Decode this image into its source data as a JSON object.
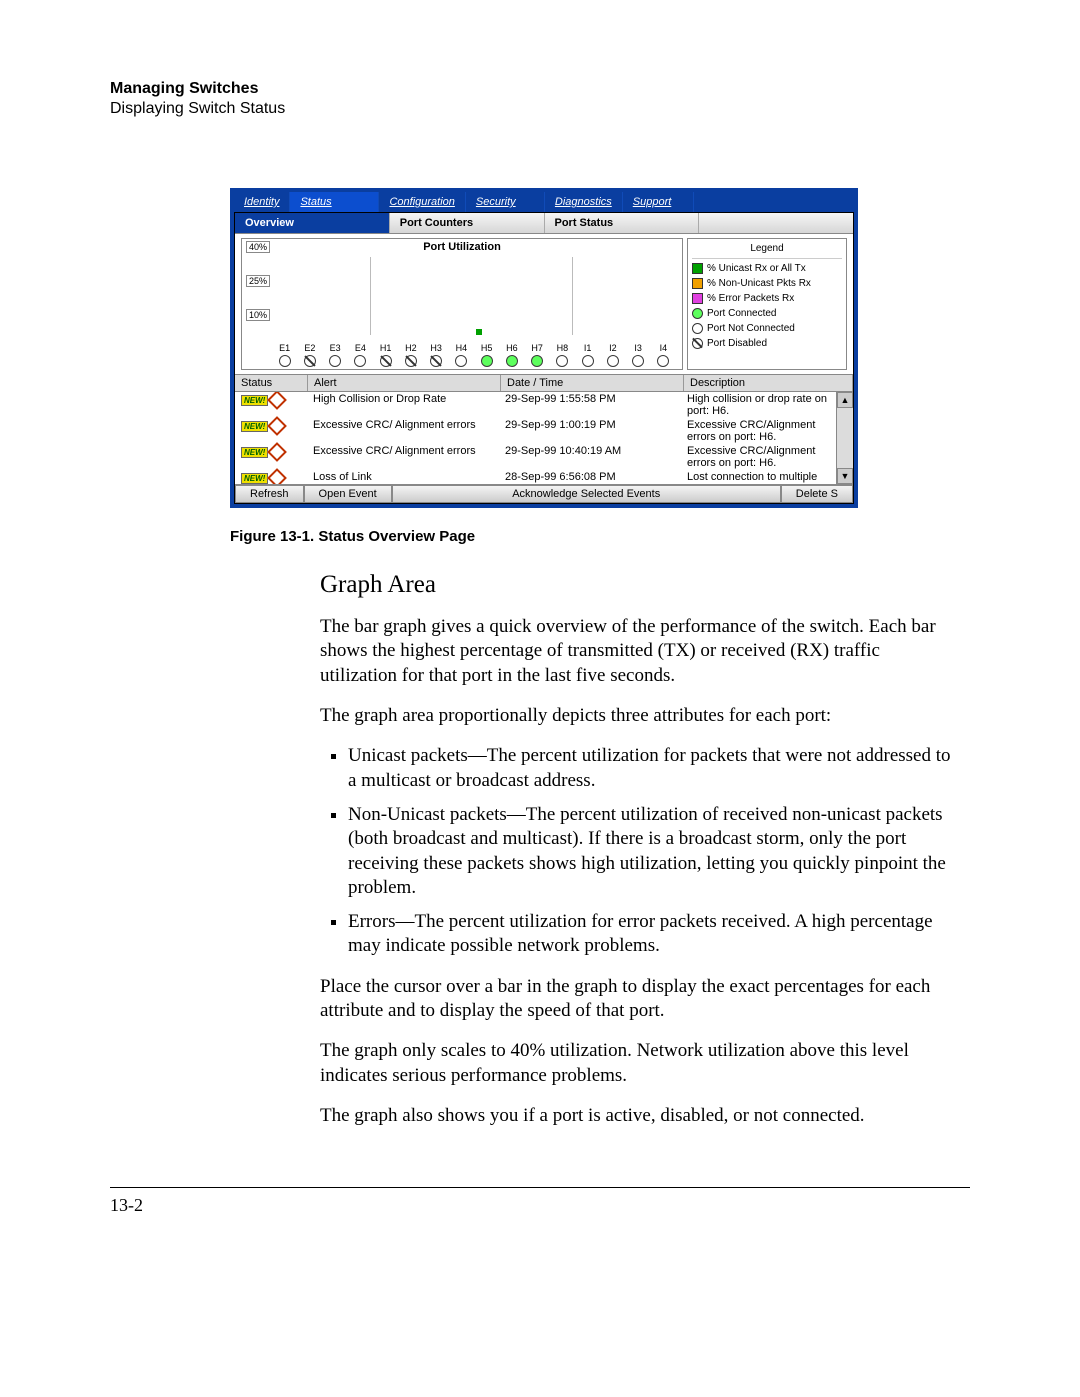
{
  "header": {
    "title": "Managing Switches",
    "subtitle": "Displaying Switch Status"
  },
  "nav": {
    "identity": "Identity",
    "status": "Status",
    "configuration": "Configuration",
    "security": "Security",
    "diagnostics": "Diagnostics",
    "support": "Support"
  },
  "subnav": {
    "overview": "Overview",
    "counters": "Port Counters",
    "portstatus": "Port Status"
  },
  "chart_data": {
    "type": "bar",
    "title": "Port Utilization",
    "ylabel": "",
    "ylim": [
      0,
      40
    ],
    "yticks": [
      "40%",
      "25%",
      "10%"
    ],
    "categories": [
      "E1",
      "E2",
      "E3",
      "E4",
      "H1",
      "H2",
      "H3",
      "H4",
      "H5",
      "H6",
      "H7",
      "H8",
      "I1",
      "I2",
      "I3",
      "I4"
    ],
    "values": [
      0,
      0,
      0,
      0,
      0,
      0,
      0,
      0,
      2,
      0,
      0,
      0,
      0,
      0,
      0,
      0
    ],
    "port_state": [
      "notconn",
      "disabled",
      "notconn",
      "notconn",
      "disabled",
      "disabled",
      "disabled",
      "notconn",
      "connected",
      "connected",
      "connected",
      "notconn",
      "notconn",
      "notconn",
      "notconn",
      "notconn"
    ]
  },
  "legend": {
    "title": "Legend",
    "l1": "% Unicast Rx or All Tx",
    "l2": "% Non-Unicast Pkts Rx",
    "l3": "% Error Packets Rx",
    "l4": "Port Connected",
    "l5": "Port Not Connected",
    "l6": "Port Disabled"
  },
  "events": {
    "h_status": "Status",
    "h_alert": "Alert",
    "h_dt": "Date / Time",
    "h_desc": "Description",
    "rows": [
      {
        "alert": "High Collision or Drop Rate",
        "dt": "29-Sep-99 1:55:58 PM",
        "desc": "High collision or drop rate on port: H6."
      },
      {
        "alert": "Excessive CRC/ Alignment errors",
        "dt": "29-Sep-99 1:00:19 PM",
        "desc": "Excessive CRC/Alignment errors on port: H6."
      },
      {
        "alert": "Excessive CRC/ Alignment errors",
        "dt": "29-Sep-99 10:40:19 AM",
        "desc": "Excessive CRC/Alignment errors on port: H6."
      },
      {
        "alert": "Loss of Link",
        "dt": "28-Sep-99 6:56:08 PM",
        "desc": "Lost connection to multiple"
      }
    ],
    "badge": "NEW!"
  },
  "buttons": {
    "refresh": "Refresh",
    "open": "Open Event",
    "ack": "Acknowledge Selected Events",
    "del": "Delete S"
  },
  "caption": "Figure 13-1. Status Overview Page",
  "body": {
    "h": "Graph Area",
    "p1": "The bar graph gives a quick overview of the performance of the switch. Each bar shows the highest percentage of transmitted (TX) or received (RX) traffic utilization for that port in the last five seconds.",
    "p2": "The graph area proportionally depicts three attributes for each port:",
    "b1": "Unicast packets—The percent utilization for packets that were not addressed to a multicast or broadcast address.",
    "b2": "Non-Unicast packets—The percent utilization of received non-unicast packets (both broadcast and multicast). If there is a broadcast storm, only the port receiving these packets shows high utilization, letting you quickly pinpoint the problem.",
    "b3": "Errors—The percent utilization for error packets received. A high percentage may indicate possible network problems.",
    "p3": "Place the cursor over a bar in the graph to display the exact percentages for each attribute and to display the speed of that port.",
    "p4": "The graph only scales to 40% utilization. Network utilization above this level indicates serious performance problems.",
    "p5": "The graph also shows you if a port is active, disabled, or not connected."
  },
  "page_number": "13-2"
}
